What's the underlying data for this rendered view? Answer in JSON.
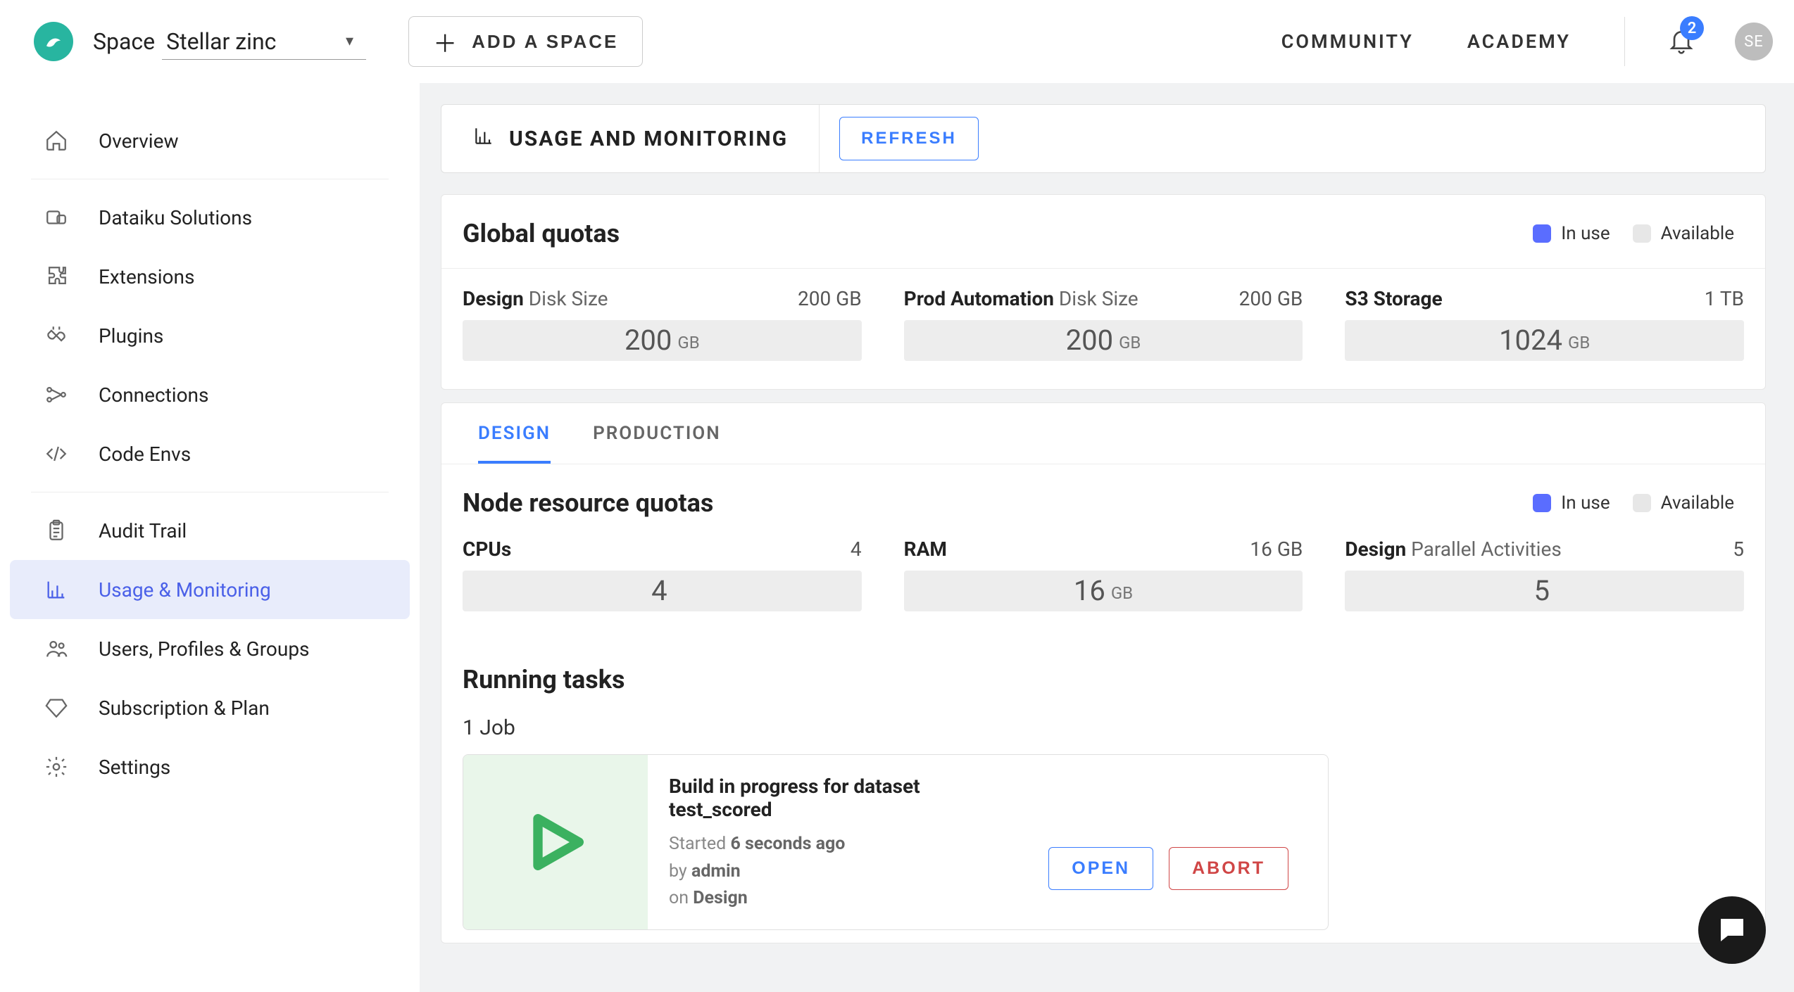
{
  "topbar": {
    "space_label": "Space",
    "space_value": "Stellar zinc",
    "add_space_label": "ADD A SPACE",
    "community": "COMMUNITY",
    "academy": "ACADEMY",
    "notif_count": "2",
    "avatar_initials": "SE"
  },
  "sidebar": {
    "items": [
      {
        "label": "Overview"
      },
      {
        "label": "Dataiku Solutions"
      },
      {
        "label": "Extensions"
      },
      {
        "label": "Plugins"
      },
      {
        "label": "Connections"
      },
      {
        "label": "Code Envs"
      },
      {
        "label": "Audit Trail"
      },
      {
        "label": "Usage & Monitoring"
      },
      {
        "label": "Users, Profiles & Groups"
      },
      {
        "label": "Subscription & Plan"
      },
      {
        "label": "Settings"
      }
    ]
  },
  "page": {
    "title": "USAGE AND MONITORING",
    "refresh": "REFRESH"
  },
  "legend": {
    "in_use": "In use",
    "available": "Available"
  },
  "global_quotas": {
    "title": "Global quotas",
    "items": [
      {
        "label_strong": "Design",
        "label_light": "Disk Size",
        "capacity": "200 GB",
        "used_value": "200",
        "used_unit": "GB"
      },
      {
        "label_strong": "Prod Automation",
        "label_light": "Disk Size",
        "capacity": "200 GB",
        "used_value": "200",
        "used_unit": "GB"
      },
      {
        "label_strong": "S3 Storage",
        "label_light": "",
        "capacity": "1 TB",
        "used_value": "1024",
        "used_unit": "GB"
      }
    ]
  },
  "tabs": {
    "design": "DESIGN",
    "production": "PRODUCTION"
  },
  "node_quotas": {
    "title": "Node resource quotas",
    "items": [
      {
        "label_strong": "CPUs",
        "label_light": "",
        "capacity": "4",
        "used_value": "4",
        "used_unit": ""
      },
      {
        "label_strong": "RAM",
        "label_light": "",
        "capacity": "16 GB",
        "used_value": "16",
        "used_unit": "GB"
      },
      {
        "label_strong": "Design",
        "label_light": "Parallel Activities",
        "capacity": "5",
        "used_value": "5",
        "used_unit": ""
      }
    ]
  },
  "running": {
    "title": "Running tasks",
    "count": "1 Job",
    "task": {
      "title": "Build in progress for dataset test_scored",
      "started_prefix": "Started ",
      "started_value": "6 seconds ago",
      "by_prefix": "by ",
      "by_value": "admin",
      "on_prefix": "on ",
      "on_value": "Design",
      "open": "OPEN",
      "abort": "ABORT"
    }
  }
}
